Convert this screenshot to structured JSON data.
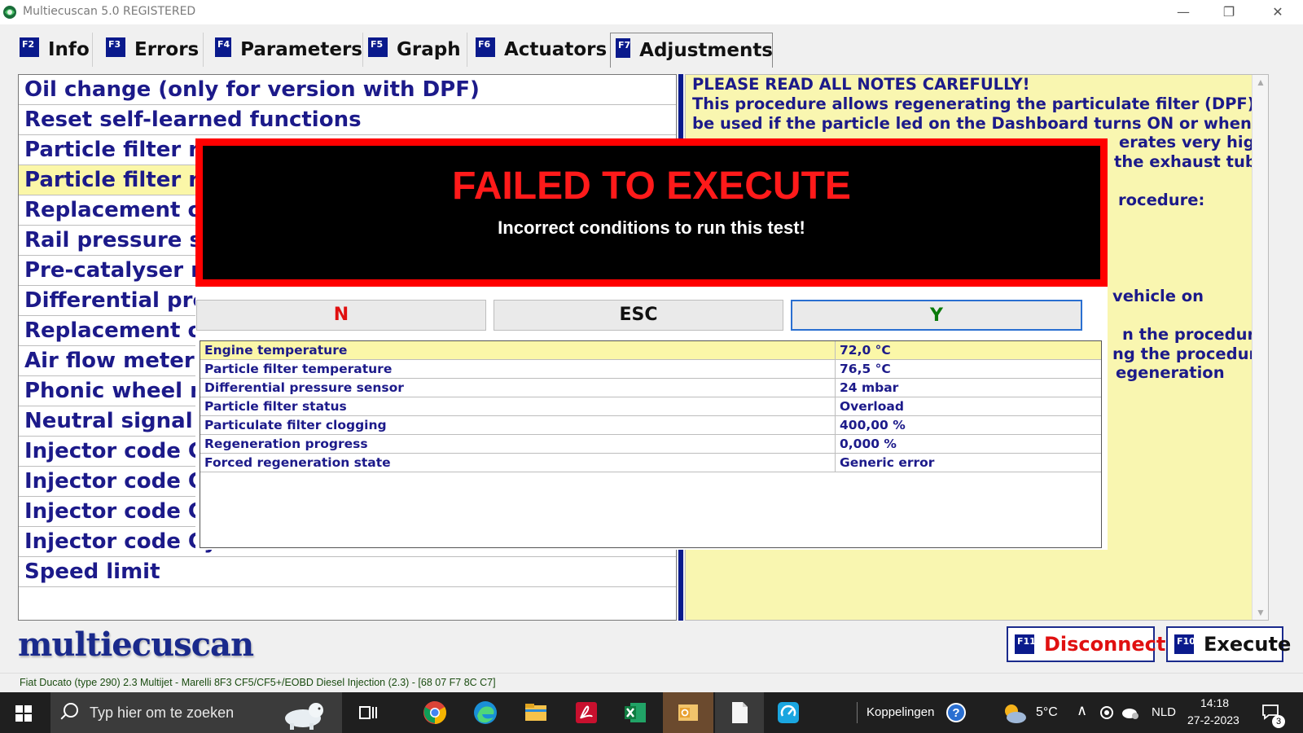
{
  "window": {
    "title": "Multiecuscan 5.0 REGISTERED"
  },
  "tabs": [
    {
      "key": "F2",
      "label": "Info"
    },
    {
      "key": "F3",
      "label": "Errors"
    },
    {
      "key": "F4",
      "label": "Parameters"
    },
    {
      "key": "F5",
      "label": "Graph"
    },
    {
      "key": "F6",
      "label": "Actuators"
    },
    {
      "key": "F7",
      "label": "Adjustments",
      "active": true
    }
  ],
  "procedures": [
    "Oil change (only for version with DPF)",
    "Reset self-learned functions",
    "Particle filter rep",
    "Particle filter reg",
    "Replacement of",
    "Rail pressure se",
    "Pre-catalyser re",
    "Differential pres",
    "Replacement of",
    "Air flow meter s",
    "Phonic wheel re",
    "Neutral signal le",
    "Injector code Cy",
    "Injector code Cy",
    "Injector code Cy",
    "Injector code Cy",
    "Speed limit"
  ],
  "selected_procedure_index": 3,
  "notes": {
    "line1": "PLEASE READ ALL NOTES CAREFULLY!",
    "line2": "This procedure allows regenerating the particulate filter (DPF) and it must",
    "line3": "be used if the particle led on the Dashboard turns ON or when a failure",
    "line4a": "erates very high",
    "line5a": "the exhaust tube is",
    "line7a": "rocedure:",
    "line12a": "vehicle on",
    "line14a": "n the procedure has",
    "line15a": "ng the procedure.",
    "line16a": "egeneration"
  },
  "dialog": {
    "title": "FAILED TO EXECUTE",
    "subtitle": "Incorrect conditions to run this test!",
    "btn_n": "N",
    "btn_esc": "ESC",
    "btn_y": "Y",
    "colors": {
      "n": "#e01010",
      "esc": "#111111",
      "y": "#0a7a0a"
    }
  },
  "parameters": [
    {
      "name": "Engine temperature",
      "value": "72,0 °C"
    },
    {
      "name": "Particle filter temperature",
      "value": "76,5 °C"
    },
    {
      "name": "Differential pressure sensor",
      "value": "24 mbar"
    },
    {
      "name": "Particle filter status",
      "value": "Overload"
    },
    {
      "name": "Particulate filter clogging",
      "value": "400,00 %"
    },
    {
      "name": "Regeneration progress",
      "value": "0,000 %"
    },
    {
      "name": "Forced regeneration state",
      "value": "Generic error"
    }
  ],
  "logo": "multiecuscan",
  "actions": {
    "disconnect": {
      "key": "F11",
      "label": "Disconnect",
      "color": "#e01010"
    },
    "execute": {
      "key": "F10",
      "label": "Execute",
      "color": "#111111"
    }
  },
  "status": "Fiat Ducato (type 290) 2.3 Multijet - Marelli 8F3 CF5/CF5+/EOBD Diesel Injection (2.3) - [68 07 F7 8C C7]",
  "taskbar": {
    "search_placeholder": "Typ hier om te zoeken",
    "links_label": "Koppelingen",
    "temperature": "5°C",
    "language": "NLD",
    "time": "14:18",
    "date": "27-2-2023",
    "notification_count": "3"
  }
}
